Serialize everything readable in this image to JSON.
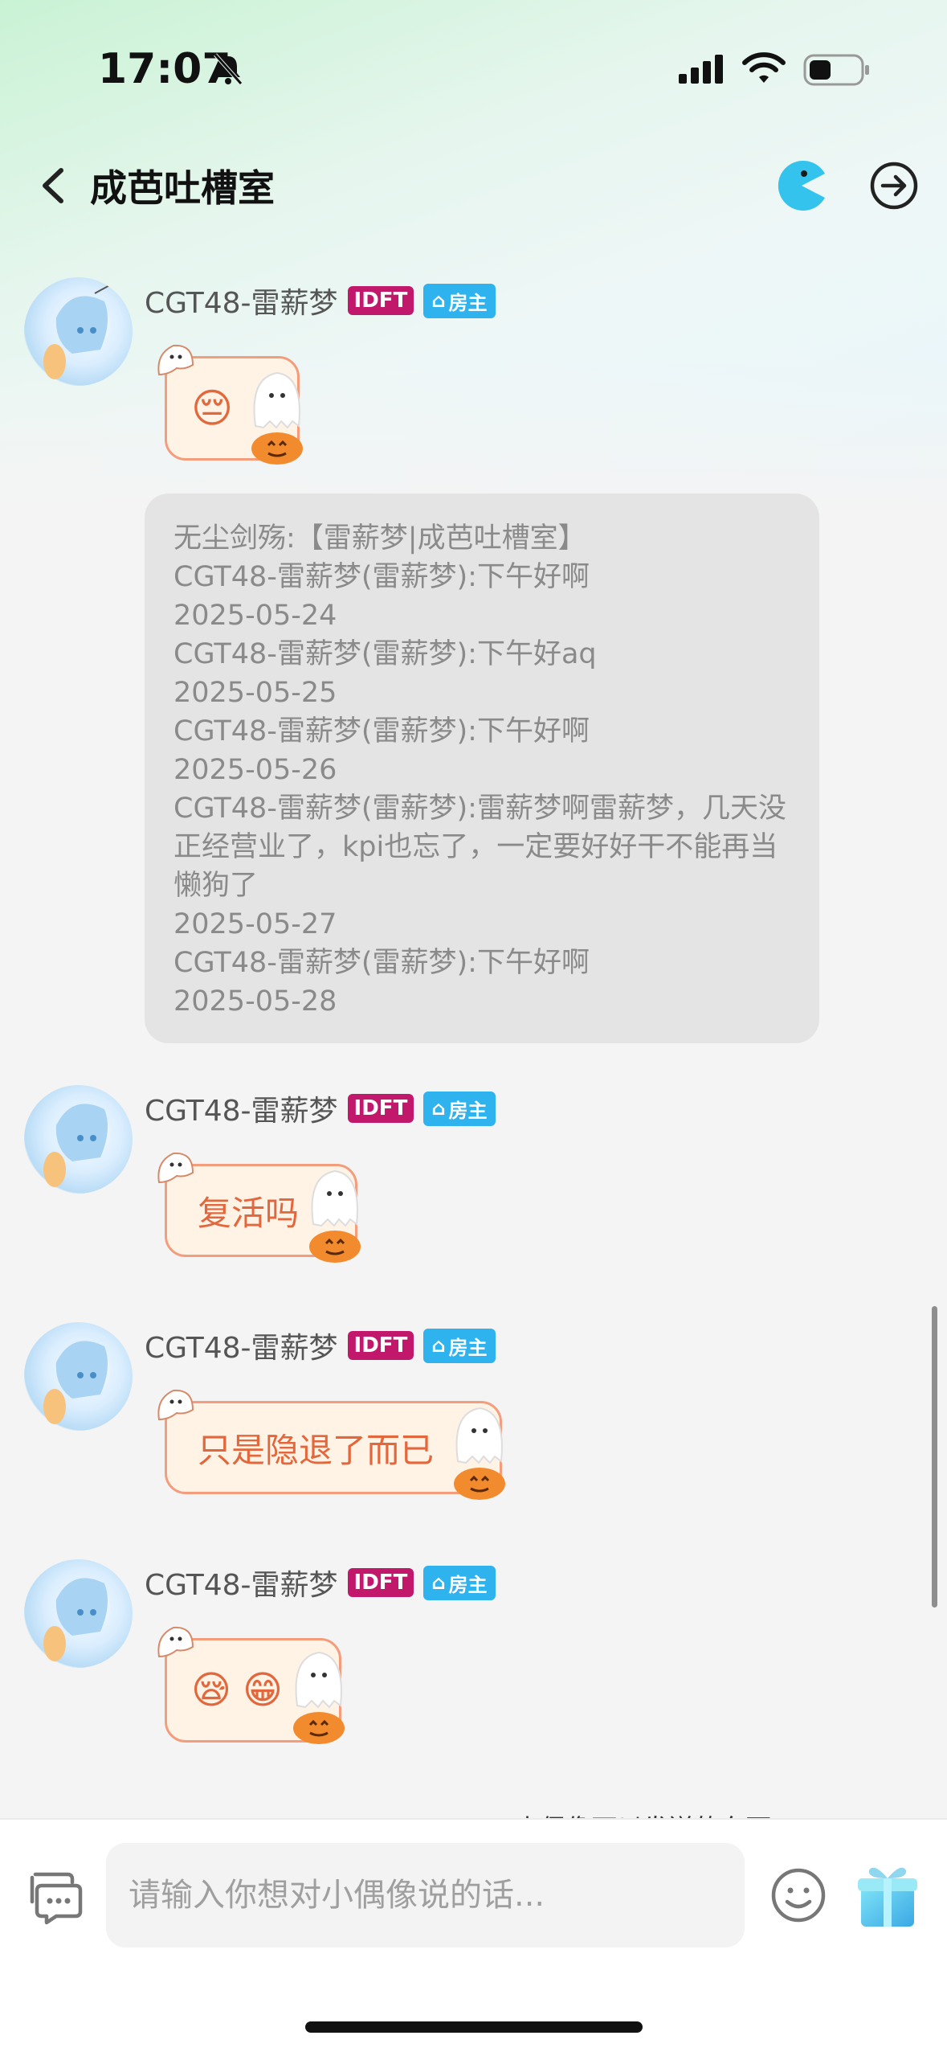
{
  "status_bar": {
    "time": "17:07"
  },
  "header": {
    "title": "成芭吐槽室"
  },
  "messages": [
    {
      "username": "CGT48-雷薪梦",
      "badge_idft": "IDFT",
      "badge_host": "房主",
      "text": "",
      "emojis": [
        "😔"
      ]
    },
    {
      "username": "CGT48-雷薪梦",
      "badge_idft": "IDFT",
      "badge_host": "房主",
      "text": "复活吗",
      "emojis": []
    },
    {
      "username": "CGT48-雷薪梦",
      "badge_idft": "IDFT",
      "badge_host": "房主",
      "text": "只是隐退了而已",
      "emojis": []
    },
    {
      "username": "CGT48-雷薪梦",
      "badge_idft": "IDFT",
      "badge_host": "房主",
      "text": "",
      "emojis": [
        "😪",
        "😁"
      ]
    }
  ],
  "system_card": {
    "lines": [
      "无尘剑殇:【雷薪梦|成芭吐槽室】",
      "CGT48-雷薪梦(雷薪梦):下午好啊",
      "2025-05-24",
      "CGT48-雷薪梦(雷薪梦):下午好aq",
      "2025-05-25",
      "CGT48-雷薪梦(雷薪梦):下午好啊",
      "2025-05-26",
      "CGT48-雷薪梦(雷薪梦):雷薪梦啊雷薪梦，几天没正经营业了，kpi也忘了，一定要好好干不能再当懒狗了",
      "2025-05-27",
      "CGT48-雷薪梦(雷薪梦):下午好啊",
      "2025-05-28"
    ]
  },
  "peek_text": "小偶像可以发送的东西",
  "input": {
    "placeholder": "请输入你想对小偶像说的话..."
  }
}
